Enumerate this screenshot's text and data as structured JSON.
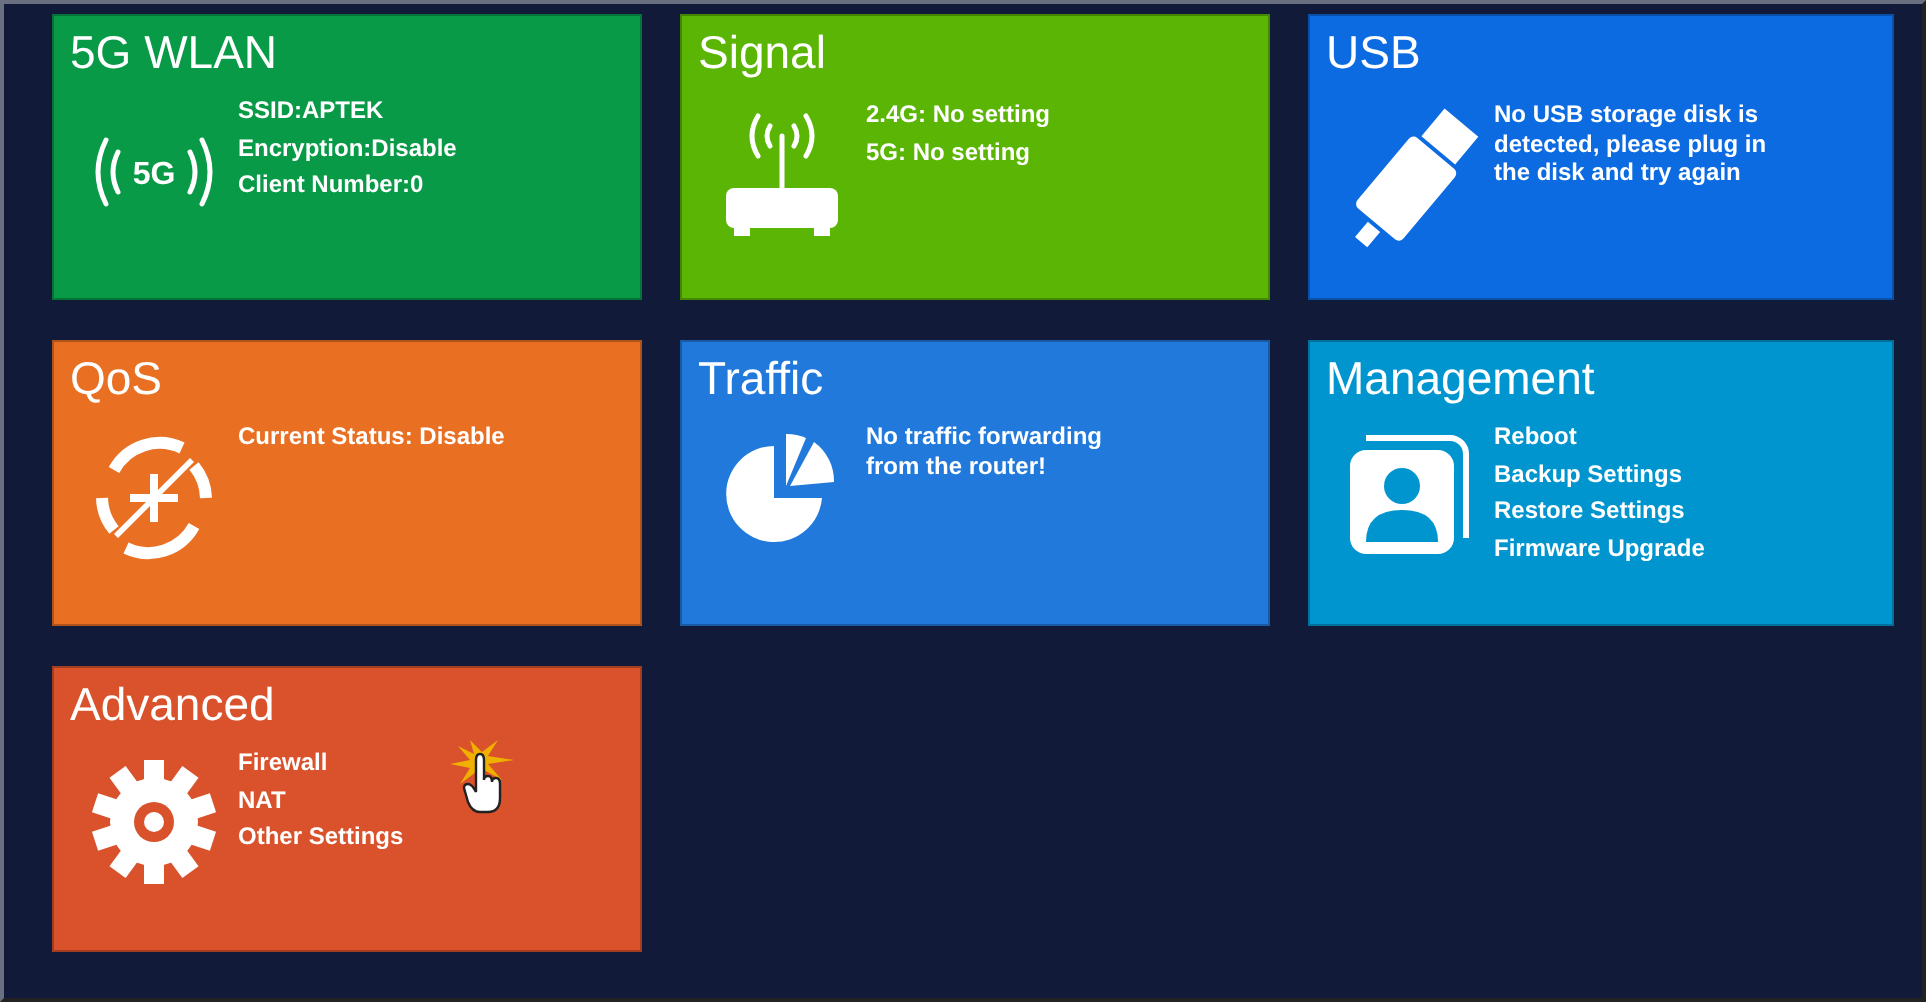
{
  "tiles": [
    {
      "kind": "wlan",
      "title": "5G WLAN",
      "color": "#099a48",
      "icon_text": "5G",
      "lines": [
        "SSID:APTEK",
        "Encryption:Disable",
        "Client Number:0"
      ]
    },
    {
      "kind": "signal",
      "title": "Signal",
      "color": "#5bb505",
      "lines": [
        "2.4G: No setting",
        "5G: No setting"
      ]
    },
    {
      "kind": "usb",
      "title": "USB",
      "color": "#0d6be2",
      "lines": [
        "No USB storage disk is detected, please plug in the disk and try again"
      ]
    },
    {
      "kind": "qos",
      "title": "QoS",
      "color": "#e96f22",
      "lines": [
        "Current Status: Disable"
      ]
    },
    {
      "kind": "traffic",
      "title": "Traffic",
      "color": "#2079db",
      "lines": [
        "No traffic forwarding from the router!"
      ]
    },
    {
      "kind": "management",
      "title": "Management",
      "color": "#0095cf",
      "lines": [
        "Reboot",
        "Backup Settings",
        "Restore Settings",
        "Firmware Upgrade"
      ]
    },
    {
      "kind": "advanced",
      "title": "Advanced",
      "color": "#d9522b",
      "lines": [
        "Firewall",
        "NAT",
        "Other Settings"
      ],
      "cursor": true
    }
  ]
}
